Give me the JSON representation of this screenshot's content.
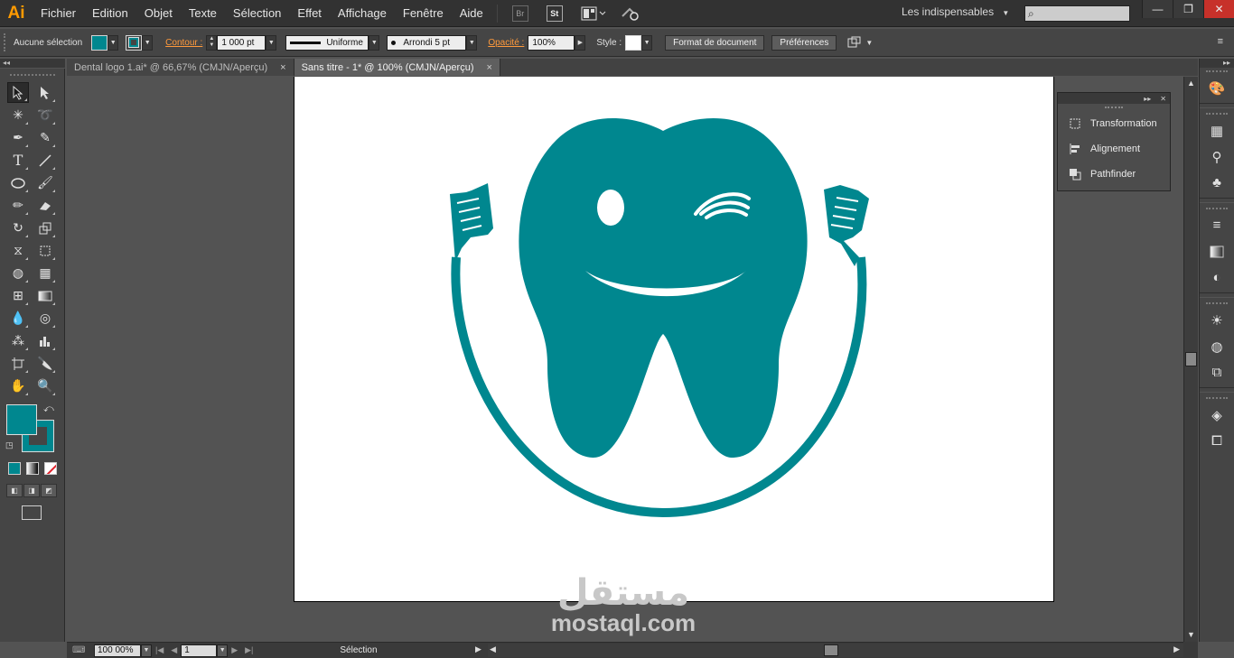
{
  "app": {
    "logo": "Ai",
    "menu": [
      "Fichier",
      "Edition",
      "Objet",
      "Texte",
      "Sélection",
      "Effet",
      "Affichage",
      "Fenêtre",
      "Aide"
    ],
    "bridge_label": "Br",
    "stock_label": "St",
    "workspace": "Les indispensables",
    "window_buttons": {
      "minimize": "—",
      "restore": "❐",
      "close": "✕"
    }
  },
  "control": {
    "selection_label": "Aucune sélection",
    "fill_color": "#00878f",
    "stroke_label": "Contour :",
    "stroke_weight": "1 000 pt",
    "stroke_profile": "Uniforme",
    "brush": "Arrondi 5 pt",
    "opacity_label": "Opacité :",
    "opacity": "100%",
    "style_label": "Style :",
    "doc_setup_btn": "Format de document",
    "prefs_btn": "Préférences"
  },
  "tabs": [
    {
      "label": "Dental logo 1.ai* @ 66,67% (CMJN/Aperçu)",
      "close": "×"
    },
    {
      "label": "Sans titre - 1* @ 100% (CMJN/Aperçu)",
      "close": "×"
    }
  ],
  "tools": {
    "fill_color": "#00878f",
    "stroke_color": "#00878f"
  },
  "artwork": {
    "color": "#00878f"
  },
  "float_panel": {
    "items": [
      "Transformation",
      "Alignement",
      "Pathfinder"
    ]
  },
  "status": {
    "zoom": "100 00%",
    "page": "1",
    "tool": "Sélection"
  },
  "watermark": {
    "arabic": "مستقل",
    "latin": "mostaql.com"
  }
}
